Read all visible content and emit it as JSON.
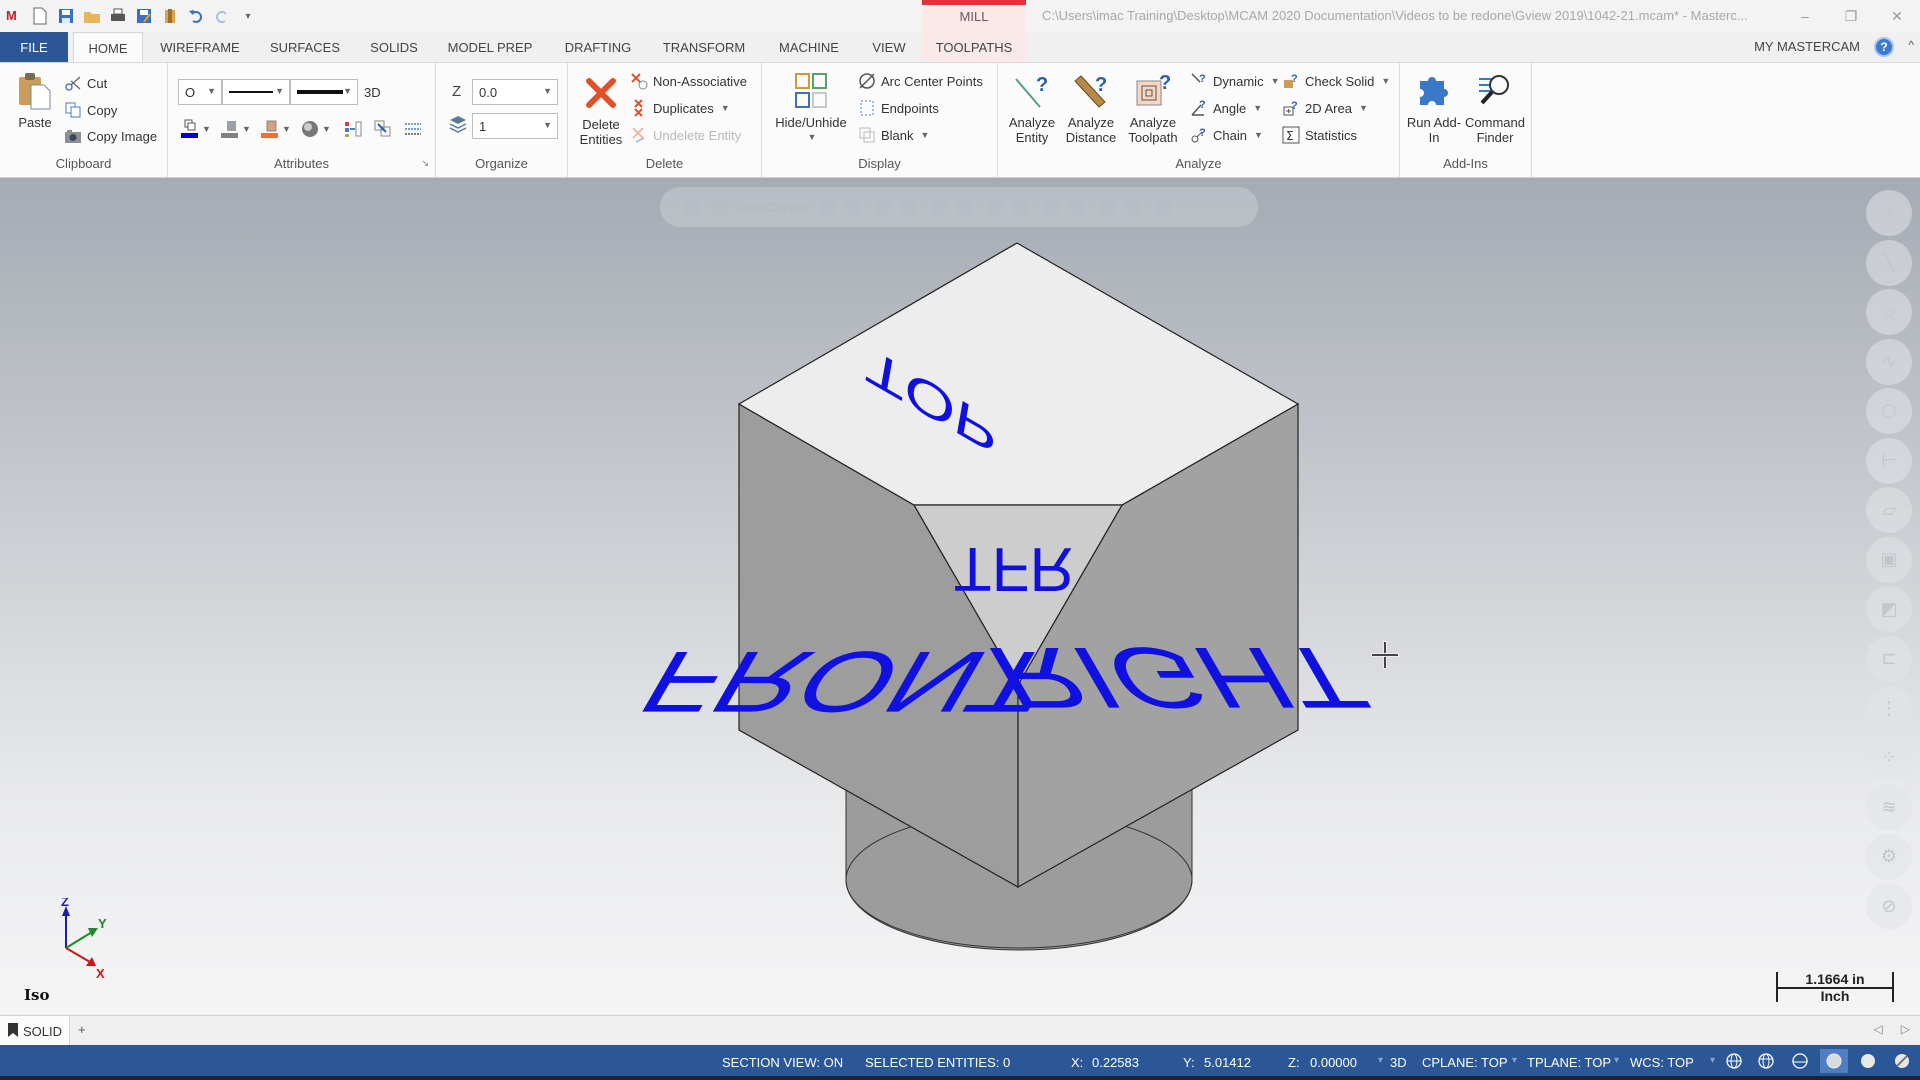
{
  "titlebar": {
    "context_tab": "MILL",
    "path": "C:\\Users\\imac Training\\Desktop\\MCAM 2020 Documentation\\Videos to be redone\\Gview 2019\\1042-21.mcam* - Masterc...",
    "quick_access": [
      "app-logo",
      "new-file",
      "save",
      "open",
      "print",
      "save-as",
      "properties",
      "undo",
      "redo",
      "customize"
    ],
    "controls": {
      "minimize": "–",
      "restore": "❐",
      "close": "✕"
    }
  },
  "tabs": {
    "items": [
      {
        "label": "FILE"
      },
      {
        "label": "HOME"
      },
      {
        "label": "WIREFRAME"
      },
      {
        "label": "SURFACES"
      },
      {
        "label": "SOLIDS"
      },
      {
        "label": "MODEL PREP"
      },
      {
        "label": "DRAFTING"
      },
      {
        "label": "TRANSFORM"
      },
      {
        "label": "MACHINE"
      },
      {
        "label": "VIEW"
      },
      {
        "label": "TOOLPATHS"
      }
    ],
    "active": "HOME",
    "my_mastercam": "MY MASTERCAM",
    "help": "?",
    "collapse": "^"
  },
  "ribbon": {
    "clipboard": {
      "label": "Clipboard",
      "paste": "Paste",
      "cut": "Cut",
      "copy": "Copy",
      "copy_image": "Copy Image"
    },
    "attributes": {
      "label": "Attributes",
      "point_style": "O",
      "line_mode": "3D",
      "colors": {
        "wireframe": "#0000cc",
        "solid": "#808080",
        "surface": "#f07030"
      }
    },
    "organize": {
      "label": "Organize",
      "z_label": "Z",
      "z_value": "0.0",
      "level_value": "1"
    },
    "delete": {
      "label": "Delete",
      "delete_entities": "Delete Entities",
      "non_associative": "Non-Associative",
      "duplicates": "Duplicates",
      "undelete_entity": "Undelete Entity"
    },
    "display": {
      "label": "Display",
      "hide_unhide": "Hide/Unhide",
      "arc_center_points": "Arc Center Points",
      "endpoints": "Endpoints",
      "blank": "Blank"
    },
    "analyze": {
      "label": "Analyze",
      "analyze_entity": "Analyze Entity",
      "analyze_distance": "Analyze Distance",
      "analyze_toolpath": "Analyze Toolpath",
      "dynamic": "Dynamic",
      "angle": "Angle",
      "chain": "Chain",
      "check_solid": "Check Solid",
      "area_2d": "2D Area",
      "statistics": "Statistics"
    },
    "addins": {
      "label": "Add-Ins",
      "run_addin": "Run Add-In",
      "command_finder": "Command Finder"
    }
  },
  "viewport": {
    "selection_bar": {
      "autocursor": "AutoCursor"
    },
    "cube_faces": {
      "top": "TOP",
      "front": "FRONT",
      "right": "RIGHT",
      "corner": "TFR"
    },
    "face_text_color": "#1010e0",
    "triad": {
      "x": "X",
      "y": "Y",
      "z": "Z"
    },
    "view_name": "Iso",
    "scale": {
      "value": "1.1664 in",
      "unit": "Inch"
    },
    "side_tools": [
      "point",
      "line",
      "circle",
      "spline",
      "solid-view",
      "dimension",
      "surface",
      "solid",
      "transform",
      "level-manager",
      "toolpath",
      "groups",
      "layers",
      "settings",
      "clear"
    ]
  },
  "sheets": {
    "active": "SOLID",
    "add": "+"
  },
  "statusbar": {
    "section_view": "SECTION VIEW: ON",
    "selected_entities": "SELECTED ENTITIES: 0",
    "x_label": "X:",
    "x_value": "0.22583",
    "y_label": "Y:",
    "y_value": "5.01412",
    "z_label": "Z:",
    "z_value": "0.00000",
    "mode": "3D",
    "cplane": "CPLANE: TOP",
    "tplane": "TPLANE: TOP",
    "wcs": "WCS: TOP"
  }
}
